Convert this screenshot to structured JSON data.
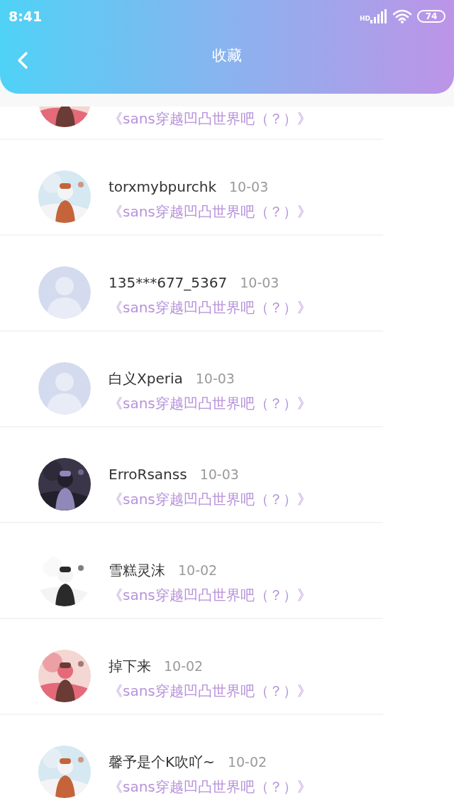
{
  "status_bar": {
    "time": "8:41",
    "network": "HD",
    "battery": "74"
  },
  "header": {
    "title": "收藏"
  },
  "items": [
    {
      "title": "《sans穿越凹凸世界吧（？）》"
    },
    {
      "name": "torxmybpurchk",
      "date": "10-03",
      "title": "《sans穿越凹凸世界吧（？）》"
    },
    {
      "avatar": {
        "kind": "default"
      },
      "name": "135***677_5367",
      "date": "10-03",
      "title": "《sans穿越凹凸世界吧（？）》"
    },
    {
      "avatar": {
        "kind": "default"
      },
      "name": "白义Xperia",
      "date": "10-03",
      "title": "《sans穿越凹凸世界吧（？）》"
    },
    {
      "name": "ErroRsanss",
      "date": "10-03",
      "title": "《sans穿越凹凸世界吧（？）》"
    },
    {
      "name": "雪糕灵沫",
      "date": "10-02",
      "title": "《sans穿越凹凸世界吧（？）》"
    },
    {
      "name": "掉下来",
      "date": "10-02",
      "title": "《sans穿越凹凸世界吧（？）》"
    },
    {
      "name": "馨予是个K吹吖~",
      "date": "10-02",
      "title": "《sans穿越凹凸世界吧（？）》"
    }
  ]
}
